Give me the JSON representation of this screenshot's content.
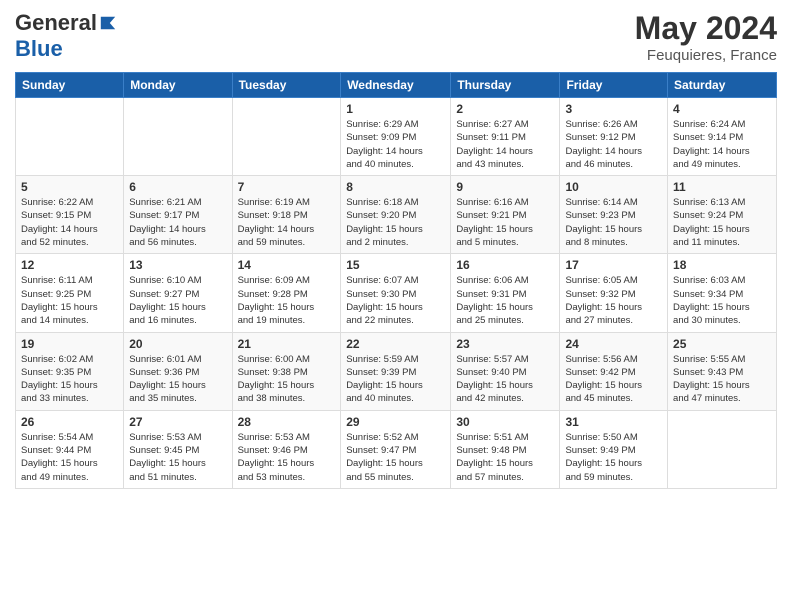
{
  "header": {
    "logo_general": "General",
    "logo_blue": "Blue",
    "month": "May 2024",
    "location": "Feuquieres, France"
  },
  "weekdays": [
    "Sunday",
    "Monday",
    "Tuesday",
    "Wednesday",
    "Thursday",
    "Friday",
    "Saturday"
  ],
  "weeks": [
    [
      {
        "day": "",
        "info": ""
      },
      {
        "day": "",
        "info": ""
      },
      {
        "day": "",
        "info": ""
      },
      {
        "day": "1",
        "info": "Sunrise: 6:29 AM\nSunset: 9:09 PM\nDaylight: 14 hours\nand 40 minutes."
      },
      {
        "day": "2",
        "info": "Sunrise: 6:27 AM\nSunset: 9:11 PM\nDaylight: 14 hours\nand 43 minutes."
      },
      {
        "day": "3",
        "info": "Sunrise: 6:26 AM\nSunset: 9:12 PM\nDaylight: 14 hours\nand 46 minutes."
      },
      {
        "day": "4",
        "info": "Sunrise: 6:24 AM\nSunset: 9:14 PM\nDaylight: 14 hours\nand 49 minutes."
      }
    ],
    [
      {
        "day": "5",
        "info": "Sunrise: 6:22 AM\nSunset: 9:15 PM\nDaylight: 14 hours\nand 52 minutes."
      },
      {
        "day": "6",
        "info": "Sunrise: 6:21 AM\nSunset: 9:17 PM\nDaylight: 14 hours\nand 56 minutes."
      },
      {
        "day": "7",
        "info": "Sunrise: 6:19 AM\nSunset: 9:18 PM\nDaylight: 14 hours\nand 59 minutes."
      },
      {
        "day": "8",
        "info": "Sunrise: 6:18 AM\nSunset: 9:20 PM\nDaylight: 15 hours\nand 2 minutes."
      },
      {
        "day": "9",
        "info": "Sunrise: 6:16 AM\nSunset: 9:21 PM\nDaylight: 15 hours\nand 5 minutes."
      },
      {
        "day": "10",
        "info": "Sunrise: 6:14 AM\nSunset: 9:23 PM\nDaylight: 15 hours\nand 8 minutes."
      },
      {
        "day": "11",
        "info": "Sunrise: 6:13 AM\nSunset: 9:24 PM\nDaylight: 15 hours\nand 11 minutes."
      }
    ],
    [
      {
        "day": "12",
        "info": "Sunrise: 6:11 AM\nSunset: 9:25 PM\nDaylight: 15 hours\nand 14 minutes."
      },
      {
        "day": "13",
        "info": "Sunrise: 6:10 AM\nSunset: 9:27 PM\nDaylight: 15 hours\nand 16 minutes."
      },
      {
        "day": "14",
        "info": "Sunrise: 6:09 AM\nSunset: 9:28 PM\nDaylight: 15 hours\nand 19 minutes."
      },
      {
        "day": "15",
        "info": "Sunrise: 6:07 AM\nSunset: 9:30 PM\nDaylight: 15 hours\nand 22 minutes."
      },
      {
        "day": "16",
        "info": "Sunrise: 6:06 AM\nSunset: 9:31 PM\nDaylight: 15 hours\nand 25 minutes."
      },
      {
        "day": "17",
        "info": "Sunrise: 6:05 AM\nSunset: 9:32 PM\nDaylight: 15 hours\nand 27 minutes."
      },
      {
        "day": "18",
        "info": "Sunrise: 6:03 AM\nSunset: 9:34 PM\nDaylight: 15 hours\nand 30 minutes."
      }
    ],
    [
      {
        "day": "19",
        "info": "Sunrise: 6:02 AM\nSunset: 9:35 PM\nDaylight: 15 hours\nand 33 minutes."
      },
      {
        "day": "20",
        "info": "Sunrise: 6:01 AM\nSunset: 9:36 PM\nDaylight: 15 hours\nand 35 minutes."
      },
      {
        "day": "21",
        "info": "Sunrise: 6:00 AM\nSunset: 9:38 PM\nDaylight: 15 hours\nand 38 minutes."
      },
      {
        "day": "22",
        "info": "Sunrise: 5:59 AM\nSunset: 9:39 PM\nDaylight: 15 hours\nand 40 minutes."
      },
      {
        "day": "23",
        "info": "Sunrise: 5:57 AM\nSunset: 9:40 PM\nDaylight: 15 hours\nand 42 minutes."
      },
      {
        "day": "24",
        "info": "Sunrise: 5:56 AM\nSunset: 9:42 PM\nDaylight: 15 hours\nand 45 minutes."
      },
      {
        "day": "25",
        "info": "Sunrise: 5:55 AM\nSunset: 9:43 PM\nDaylight: 15 hours\nand 47 minutes."
      }
    ],
    [
      {
        "day": "26",
        "info": "Sunrise: 5:54 AM\nSunset: 9:44 PM\nDaylight: 15 hours\nand 49 minutes."
      },
      {
        "day": "27",
        "info": "Sunrise: 5:53 AM\nSunset: 9:45 PM\nDaylight: 15 hours\nand 51 minutes."
      },
      {
        "day": "28",
        "info": "Sunrise: 5:53 AM\nSunset: 9:46 PM\nDaylight: 15 hours\nand 53 minutes."
      },
      {
        "day": "29",
        "info": "Sunrise: 5:52 AM\nSunset: 9:47 PM\nDaylight: 15 hours\nand 55 minutes."
      },
      {
        "day": "30",
        "info": "Sunrise: 5:51 AM\nSunset: 9:48 PM\nDaylight: 15 hours\nand 57 minutes."
      },
      {
        "day": "31",
        "info": "Sunrise: 5:50 AM\nSunset: 9:49 PM\nDaylight: 15 hours\nand 59 minutes."
      },
      {
        "day": "",
        "info": ""
      }
    ]
  ]
}
